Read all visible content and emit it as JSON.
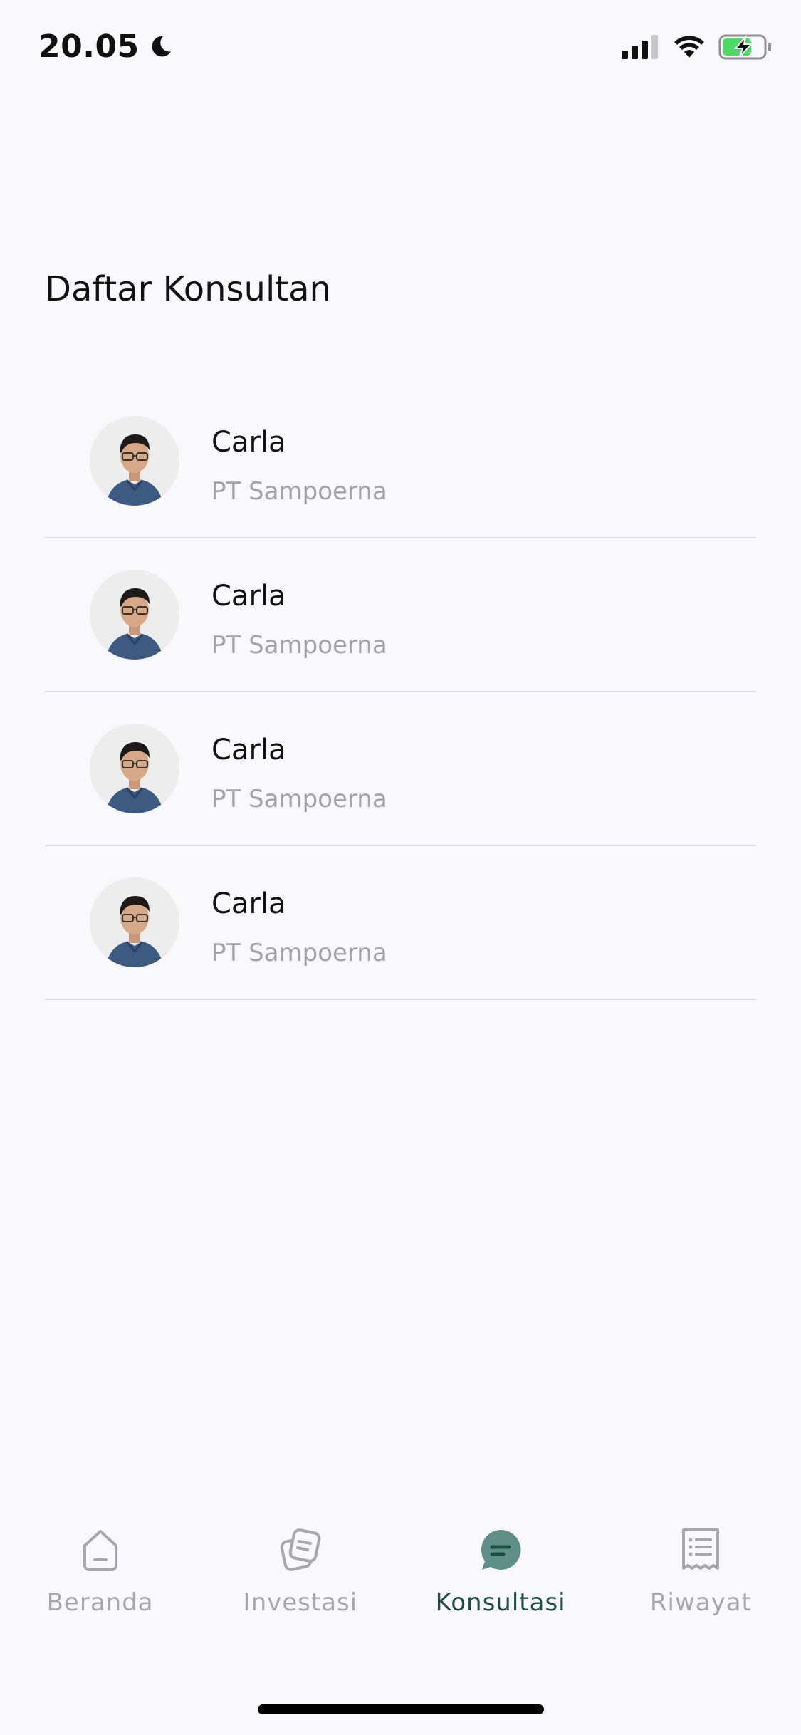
{
  "status_bar": {
    "time": "20.05"
  },
  "title": "Daftar Konsultan",
  "consultants": [
    {
      "name": "Carla",
      "company": "PT Sampoerna"
    },
    {
      "name": "Carla",
      "company": "PT Sampoerna"
    },
    {
      "name": "Carla",
      "company": "PT Sampoerna"
    },
    {
      "name": "Carla",
      "company": "PT Sampoerna"
    }
  ],
  "nav": [
    {
      "label": "Beranda",
      "icon": "home-icon",
      "active": false
    },
    {
      "label": "Investasi",
      "icon": "investment-icon",
      "active": false
    },
    {
      "label": "Konsultasi",
      "icon": "chat-icon",
      "active": true
    },
    {
      "label": "Riwayat",
      "icon": "history-icon",
      "active": false
    }
  ],
  "colors": {
    "accent": "#1f4d3f",
    "accent_icon": "#5f8f86",
    "inactive": "#a7a7ad",
    "background": "#f8f8fd",
    "battery_fill": "#4cd964"
  }
}
